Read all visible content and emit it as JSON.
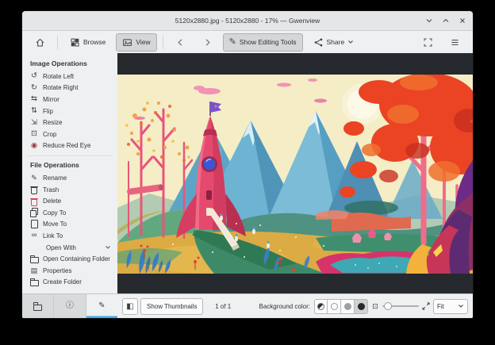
{
  "window": {
    "title": "5120x2880.jpg - 5120x2880 - 17% — Gwenview",
    "controls": [
      "minimize",
      "maximize",
      "close"
    ]
  },
  "toolbar": {
    "browse": "Browse",
    "view": "View",
    "show_editing_tools": "Show Editing Tools",
    "share": "Share",
    "icons": [
      "home",
      "browse-grid",
      "view-image",
      "back",
      "forward",
      "pencil",
      "share-nodes",
      "fullscreen",
      "hamburger-menu"
    ]
  },
  "sidebar": {
    "sections": [
      {
        "title": "Image Operations",
        "items": [
          {
            "icon": "rotate-left",
            "label": "Rotate Left"
          },
          {
            "icon": "rotate-right",
            "label": "Rotate Right"
          },
          {
            "icon": "mirror",
            "label": "Mirror"
          },
          {
            "icon": "flip",
            "label": "Flip"
          },
          {
            "icon": "resize",
            "label": "Resize"
          },
          {
            "icon": "crop",
            "label": "Crop"
          },
          {
            "icon": "red-eye",
            "label": "Reduce Red Eye"
          }
        ]
      },
      {
        "title": "File Operations",
        "items": [
          {
            "icon": "rename",
            "label": "Rename"
          },
          {
            "icon": "trash",
            "label": "Trash"
          },
          {
            "icon": "delete",
            "label": "Delete"
          },
          {
            "icon": "copy",
            "label": "Copy To"
          },
          {
            "icon": "move",
            "label": "Move To"
          },
          {
            "icon": "link",
            "label": "Link To"
          },
          {
            "icon": "none",
            "label": "Open With"
          },
          {
            "icon": "folder-open",
            "label": "Open Containing Folder"
          },
          {
            "icon": "document",
            "label": "Properties"
          },
          {
            "icon": "folder-new",
            "label": "Create Folder"
          }
        ]
      }
    ],
    "tabs": [
      "folder",
      "info",
      "edit"
    ]
  },
  "statusbar": {
    "show_thumbnails": "Show Thumbnails",
    "counter": "1 of 1",
    "background_color_label": "Background color:",
    "zoom_mode": "Fit",
    "icons": [
      "thumbnail-bar-toggle",
      "background-auto",
      "background-white",
      "background-gray",
      "background-black",
      "zoom-fit",
      "zoom-full"
    ]
  },
  "colors": {
    "accent": "#3daee9",
    "viewer_background": "#26292d",
    "delete_red": "#da4453"
  }
}
